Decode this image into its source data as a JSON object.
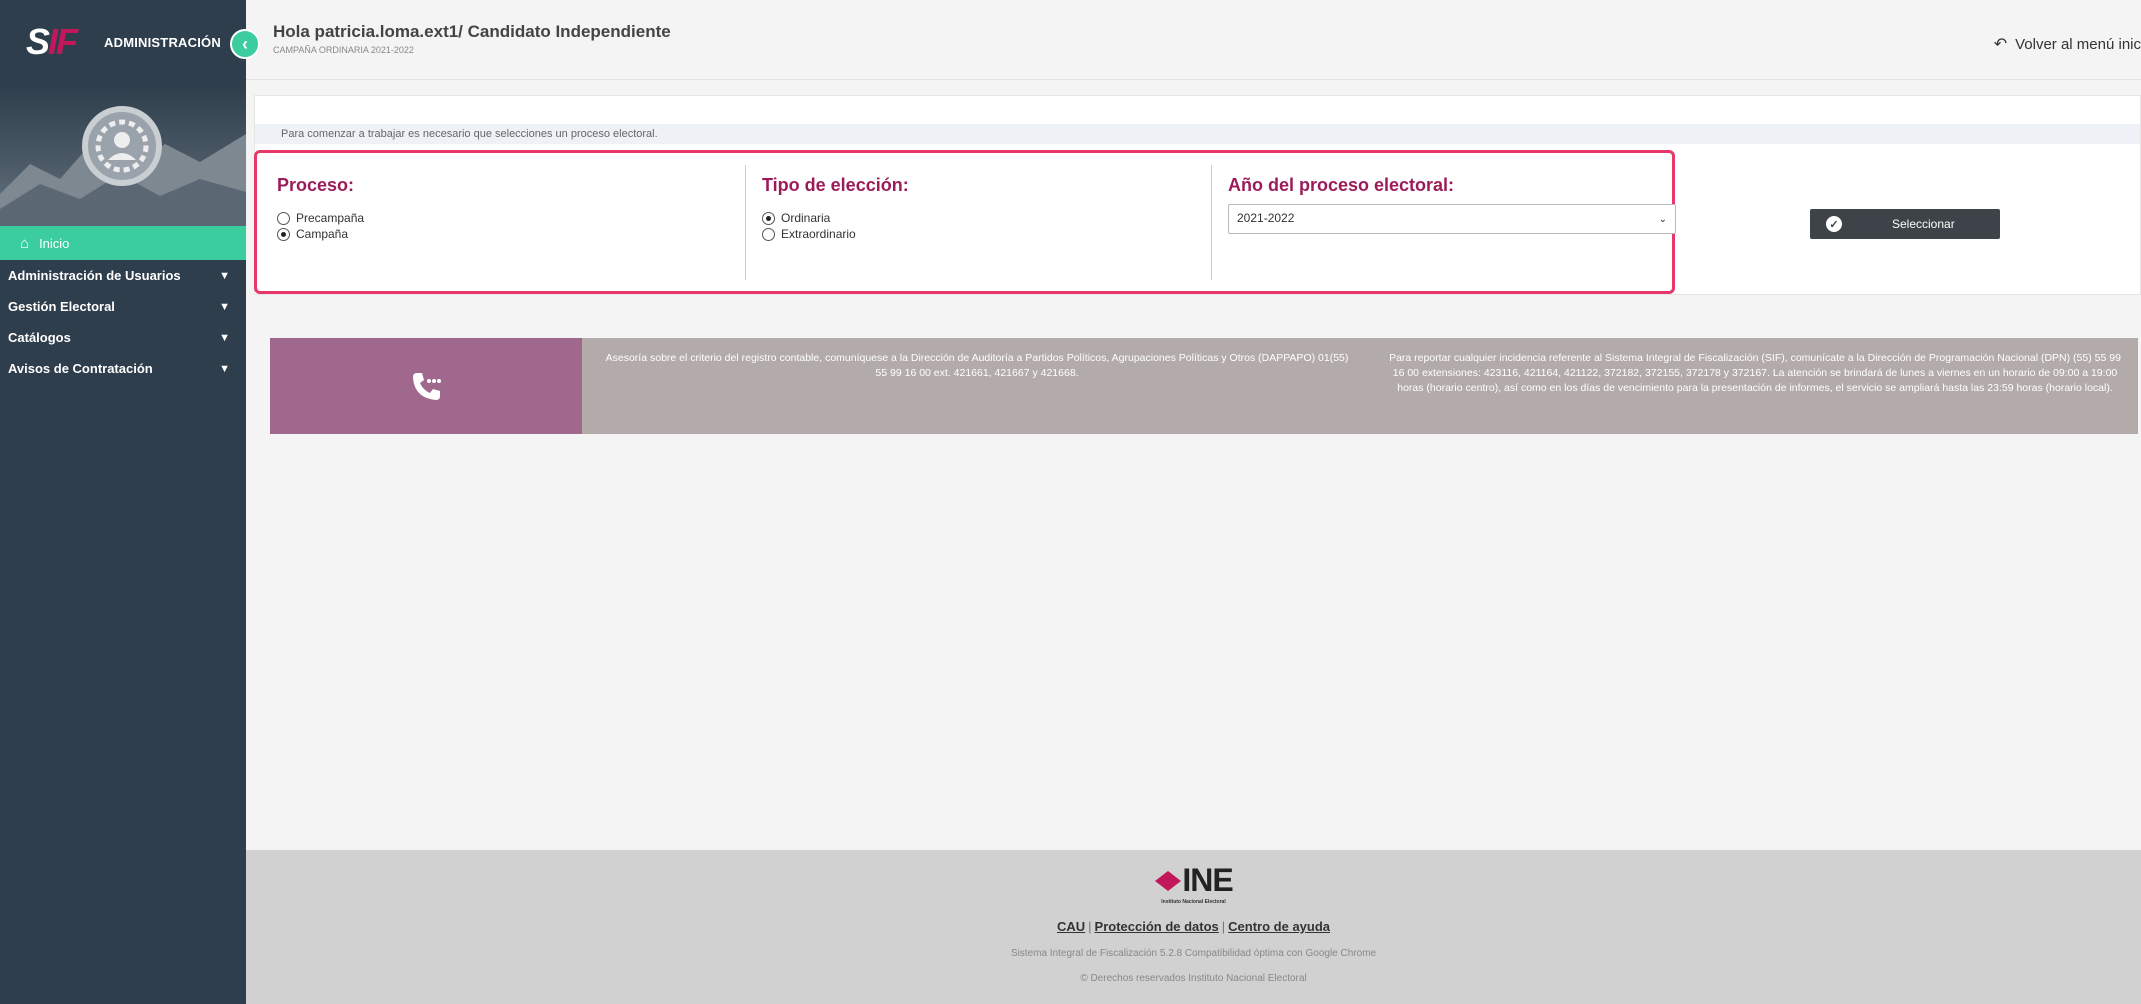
{
  "sidebar": {
    "brand_logo_main": "S",
    "brand_logo_accent": "IF",
    "brand_title": "ADMINISTRACIÓN",
    "items": [
      {
        "label": "Inicio",
        "active": true
      },
      {
        "label": "Administración de Usuarios"
      },
      {
        "label": "Gestión Electoral"
      },
      {
        "label": "Catálogos"
      },
      {
        "label": "Avisos de Contratación"
      }
    ]
  },
  "header": {
    "greeting": "Hola patricia.loma.ext1/ Candidato Independiente",
    "campaign": "CAMPAÑA ORDINARIA 2021-2022",
    "back_link": "Volver al menú inic"
  },
  "panel": {
    "info": "Para comenzar a trabajar es necesario que selecciones un proceso electoral.",
    "proceso": {
      "title": "Proceso:",
      "options": [
        {
          "label": "Precampaña",
          "checked": false
        },
        {
          "label": "Campaña",
          "checked": true
        }
      ]
    },
    "tipo": {
      "title": "Tipo de elección:",
      "options": [
        {
          "label": "Ordinaria",
          "checked": true
        },
        {
          "label": "Extraordinario",
          "checked": false
        }
      ]
    },
    "anio": {
      "title": "Año del proceso electoral:",
      "selected": "2021-2022"
    },
    "select_button": "Seleccionar"
  },
  "banner": {
    "text1": "Asesoría sobre el criterio del registro contable, comuníquese a la Dirección de Auditoría a Partidos Políticos, Agrupaciones Políticas y Otros (DAPPAPO) 01(55) 55 99 16 00 ext. 421661, 421667 y 421668.",
    "text2": "Para reportar cualquier incidencia referente al Sistema Integral de Fiscalización (SIF), comunícate a la Dirección de Programación Nacional (DPN) (55) 55 99 16 00 extensiones: 423116, 421164, 421122, 372182, 372155, 372178 y 372167. La atención se brindará de lunes a viernes en un horario de 09:00 a 19:00 horas (horario centro), así como en los días de vencimiento para la presentación de informes, el servicio se ampliará hasta las 23:59 horas (horario local)."
  },
  "footer": {
    "logo_text": "INE",
    "logo_sub": "Instituto Nacional Electoral",
    "link_cau": "CAU",
    "link_proteccion": "Protección de datos",
    "link_ayuda": "Centro de ayuda",
    "separator": "|",
    "system": "Sistema Integral de Fiscalización 5.2.8 Compatibilidad óptima con Google Chrome",
    "rights": "© Derechos reservados Instituto Nacional Electoral"
  },
  "colors": {
    "sidebar_bg": "#2f3e4c",
    "accent_green": "#3ccd9e",
    "highlight_border": "#e8386a",
    "section_title": "#9c1c5a",
    "banner_purple": "#a1688e",
    "banner_gray": "#b3abaa"
  }
}
